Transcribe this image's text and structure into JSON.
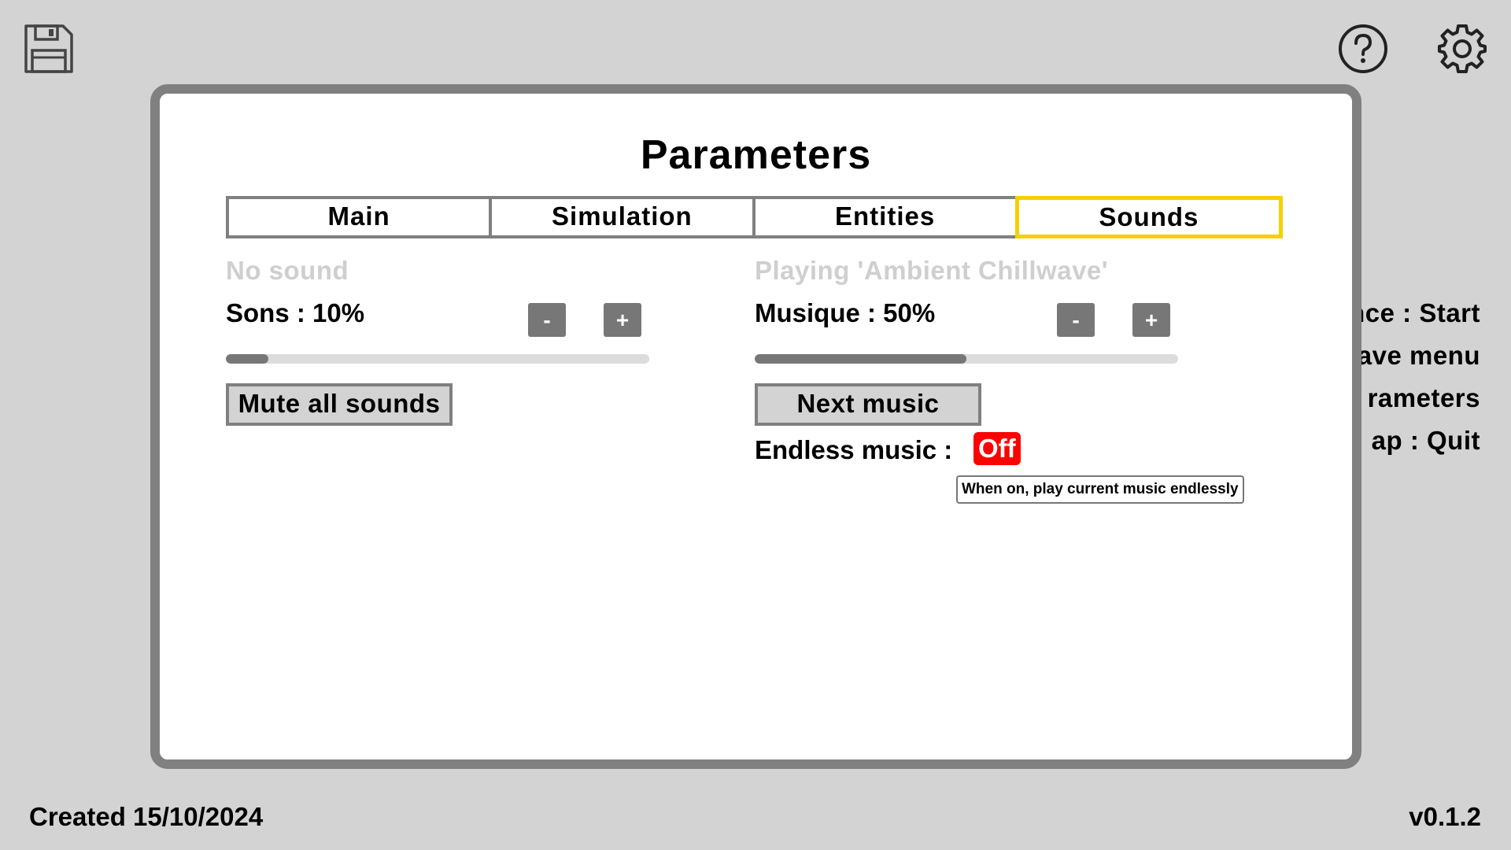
{
  "icons": {
    "save": "save-icon",
    "help": "help-icon",
    "settings": "gear-icon"
  },
  "background_menu": [
    "nce : Start",
    "ave menu",
    "rameters",
    "ap : Quit"
  ],
  "footer": {
    "created": "Created 15/10/2024",
    "version": "v0.1.2"
  },
  "panel": {
    "title": "Parameters",
    "tabs": [
      {
        "label": "Main",
        "active": false
      },
      {
        "label": "Simulation",
        "active": false
      },
      {
        "label": "Entities",
        "active": false
      },
      {
        "label": "Sounds",
        "active": true
      }
    ],
    "sounds": {
      "status": "No sound",
      "volume_label": "Sons : 10%",
      "volume_fraction": 0.1,
      "minus_label": "-",
      "plus_label": "+",
      "mute_button": "Mute all sounds"
    },
    "music": {
      "status": "Playing 'Ambient Chillwave'",
      "volume_label": "Musique : 50%",
      "volume_fraction": 0.5,
      "minus_label": "-",
      "plus_label": "+",
      "next_button": "Next music",
      "endless_label": "Endless music :",
      "endless_value": "Off",
      "endless_tooltip": "When on, play current music endlessly"
    }
  },
  "colors": {
    "background": "#d3d3d3",
    "panel_border": "#808080",
    "active_tab": "#f5d000",
    "toggle_off": "#ff0000",
    "status_text": "#cfcfcf"
  }
}
